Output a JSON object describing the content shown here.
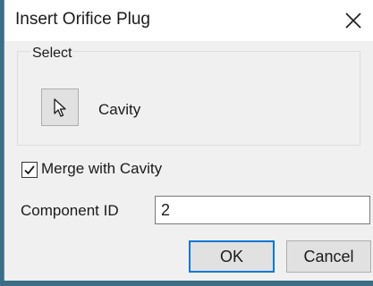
{
  "dialog": {
    "title": "Insert Orifice Plug",
    "close_icon": "close-icon"
  },
  "select_group": {
    "legend": "Select",
    "selector_icon": "cursor-arrow-icon",
    "selected_entity": "Cavity"
  },
  "merge": {
    "checked": true,
    "label": "Merge with Cavity"
  },
  "component": {
    "label": "Component ID",
    "value": "2"
  },
  "buttons": {
    "ok_label": "OK",
    "cancel_label": "Cancel"
  },
  "colors": {
    "background": "#3c6f86",
    "dialog_body": "#f0f0f0",
    "titlebar": "#ffffff",
    "default_button_border": "#0078d7"
  }
}
